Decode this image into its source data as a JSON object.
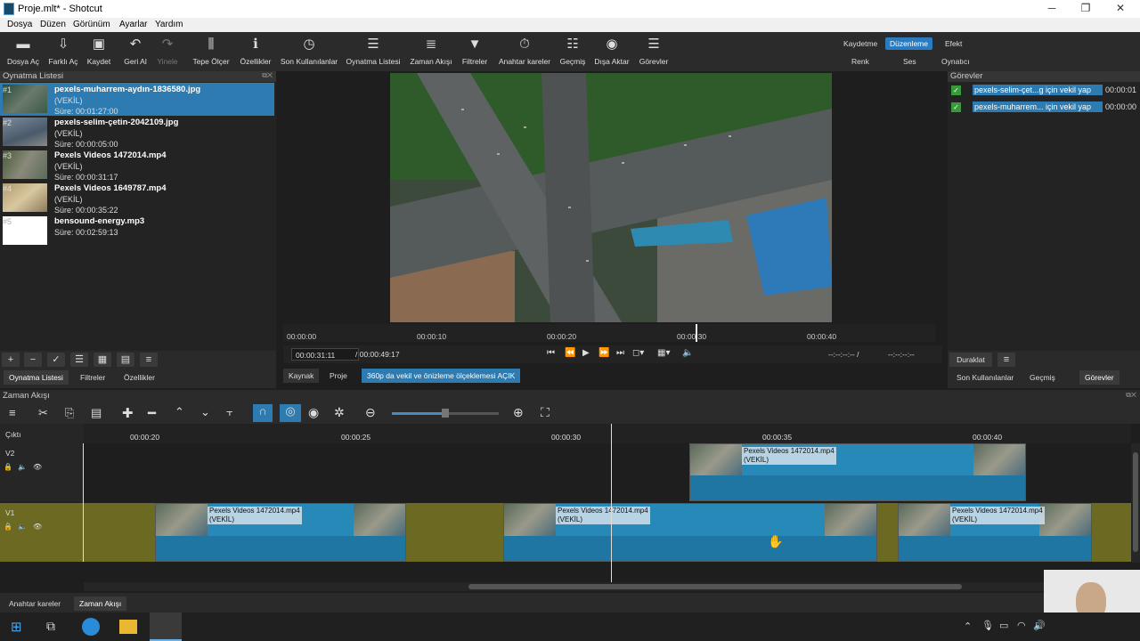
{
  "window": {
    "title": "Proje.mlt* - Shotcut"
  },
  "menu": [
    "Dosya",
    "Düzen",
    "Görünüm",
    "Ayarlar",
    "Yardım"
  ],
  "toolbar": [
    {
      "label": "Dosya Aç",
      "icon": "folder-open-icon",
      "glyph": "▬"
    },
    {
      "label": "Farklı Aç",
      "icon": "open-other-icon",
      "glyph": "⇩"
    },
    {
      "label": "Kaydet",
      "icon": "save-icon",
      "glyph": "▣"
    },
    {
      "label": "Geri Al",
      "icon": "undo-icon",
      "glyph": "↶"
    },
    {
      "label": "Yinele",
      "icon": "redo-icon",
      "glyph": "↷"
    },
    {
      "label": "Tepe Ölçer",
      "icon": "peak-meter-icon",
      "glyph": "⫼"
    },
    {
      "label": "Özellikler",
      "icon": "info-icon",
      "glyph": "ℹ"
    },
    {
      "label": "Son Kullanılanlar",
      "icon": "clock-icon",
      "glyph": "◷"
    },
    {
      "label": "Oynatma Listesi",
      "icon": "list-icon",
      "glyph": "☰"
    },
    {
      "label": "Zaman Akışı",
      "icon": "timeline-icon",
      "glyph": "≣"
    },
    {
      "label": "Filtreler",
      "icon": "filter-icon",
      "glyph": "▼"
    },
    {
      "label": "Anahtar kareler",
      "icon": "stopwatch-icon",
      "glyph": "⏱"
    },
    {
      "label": "Geçmiş",
      "icon": "history-icon",
      "glyph": "☷"
    },
    {
      "label": "Dışa Aktar",
      "icon": "export-icon",
      "glyph": "◉"
    },
    {
      "label": "Görevler",
      "icon": "jobs-icon",
      "glyph": "☰"
    }
  ],
  "layouts": {
    "row1": [
      "Kaydetme",
      "Düzenleme",
      "Efekt"
    ],
    "row2": [
      "Renk",
      "Ses",
      "Oynatıcı"
    ],
    "active": "Düzenleme"
  },
  "playlist": {
    "title": "Oynatma Listesi",
    "items": [
      {
        "num": "#1",
        "name": "pexels-muharrem-aydın-1836580.jpg",
        "line2": "(VEKİL)",
        "line3": "Süre: 00:01:27:00",
        "selected": true
      },
      {
        "num": "#2",
        "name": "pexels-selim-çetin-2042109.jpg",
        "line2": "(VEKİL)",
        "line3": "Süre: 00:00:05:00",
        "selected": false
      },
      {
        "num": "#3",
        "name": "Pexels Videos 1472014.mp4",
        "line2": "(VEKİL)",
        "line3": "Süre: 00:00:31:17",
        "selected": false
      },
      {
        "num": "#4",
        "name": "Pexels Videos 1649787.mp4",
        "line2": "(VEKİL)",
        "line3": "Süre: 00:00:35:22",
        "selected": false
      },
      {
        "num": "#5",
        "name": "bensound-energy.mp3",
        "line2": "Süre: 00:02:59:13",
        "line3": "",
        "selected": false
      }
    ],
    "tabs": [
      "Oynatma Listesi",
      "Filtreler",
      "Özellikler"
    ]
  },
  "player": {
    "ruler": [
      "00:00:00",
      "00:00:10",
      "00:00:20",
      "00:00:30",
      "00:00:40"
    ],
    "current_time": "00:00:31:11",
    "total_time": "/ 00:00:49:17",
    "in_out": "--:--:--:-- /",
    "duration": "--:--:--:--",
    "tabs": [
      "Kaynak",
      "Proje"
    ],
    "proxy_notice": "360p da vekil ve önizleme ölçeklemesi AÇIK"
  },
  "jobs": {
    "title": "Görevler",
    "items": [
      {
        "name": "pexels-selim-çet...g için vekil yap",
        "time": "00:00:01"
      },
      {
        "name": "pexels-muharrem... için vekil yap",
        "time": "00:00:00"
      }
    ],
    "pause": "Duraklat",
    "tabs": [
      "Son Kullanılanlar",
      "Geçmiş",
      "Görevler"
    ]
  },
  "timeline": {
    "title": "Zaman Akışı",
    "output_label": "Çıktı",
    "ticks": [
      "00:00:20",
      "00:00:25",
      "00:00:30",
      "00:00:35",
      "00:00:40"
    ],
    "tracks": [
      "V2",
      "V1"
    ],
    "clip_name": "Pexels Videos 1472014.mp4",
    "clip_proxy": "(VEKİL)"
  },
  "bottom_tabs": [
    "Anahtar kareler",
    "Zaman Akışı"
  ]
}
